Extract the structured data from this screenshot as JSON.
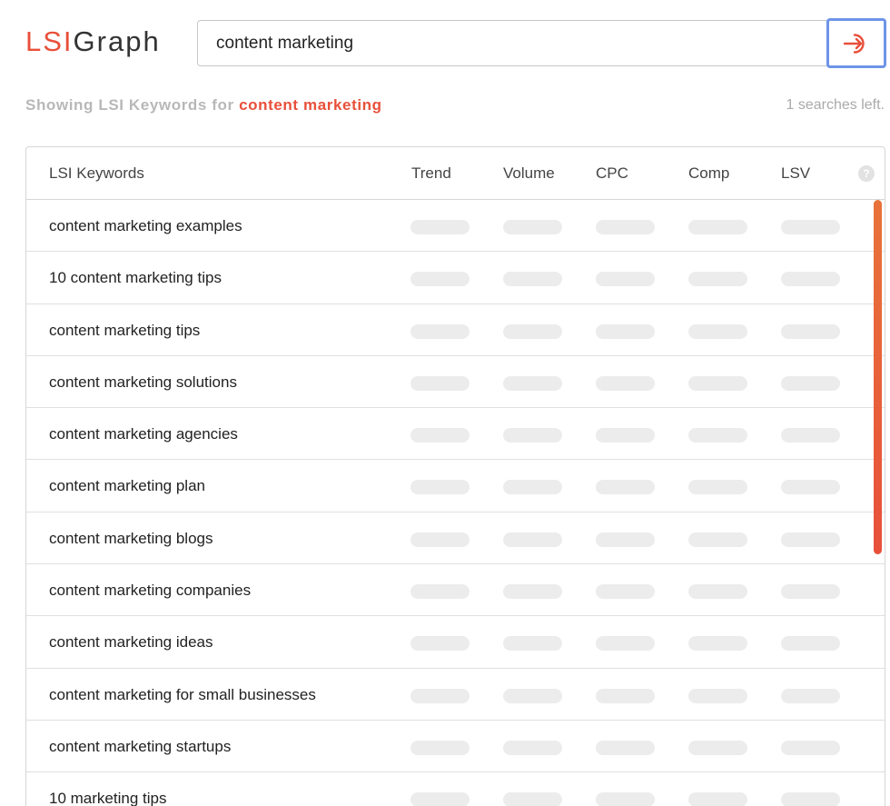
{
  "app": {
    "logo_lsi": "LSI",
    "logo_graph": "Graph",
    "brand_color": "#e8503a",
    "focus_color": "#6e94e8"
  },
  "search": {
    "value": "content marketing",
    "button_icon": "arrow-into-circle-icon"
  },
  "results": {
    "showing_prefix": "Showing LSI Keywords for",
    "keyword": "content marketing",
    "searches_left": "1 searches left."
  },
  "table": {
    "columns": [
      "LSI Keywords",
      "Trend",
      "Volume",
      "CPC",
      "Comp",
      "LSV"
    ],
    "help_icon": "?",
    "rows": [
      "content marketing examples",
      "10 content marketing tips",
      "content marketing tips",
      "content marketing solutions",
      "content marketing agencies",
      "content marketing plan",
      "content marketing blogs",
      "content marketing companies",
      "content marketing ideas",
      "content marketing for small businesses",
      "content marketing startups",
      "10 marketing tips"
    ]
  }
}
